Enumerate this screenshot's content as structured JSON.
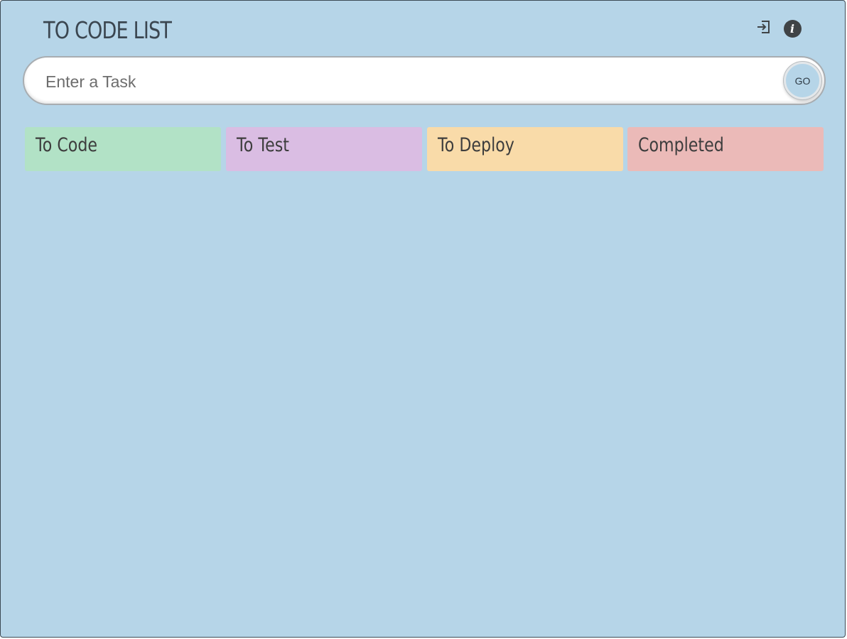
{
  "app": {
    "title": "TO CODE LIST"
  },
  "header": {
    "login_icon": "login-icon",
    "info_icon": "info-icon",
    "info_glyph": "i"
  },
  "task_entry": {
    "placeholder": "Enter a Task",
    "value": "",
    "go_label": "GO"
  },
  "columns": [
    {
      "label": "To Code",
      "color": "#b2e2c6"
    },
    {
      "label": "To Test",
      "color": "#dabde3"
    },
    {
      "label": "To Deploy",
      "color": "#f9dba9"
    },
    {
      "label": "Completed",
      "color": "#ebbab8"
    }
  ],
  "colors": {
    "background": "#b6d5e8",
    "text_dark": "#3b4650"
  }
}
